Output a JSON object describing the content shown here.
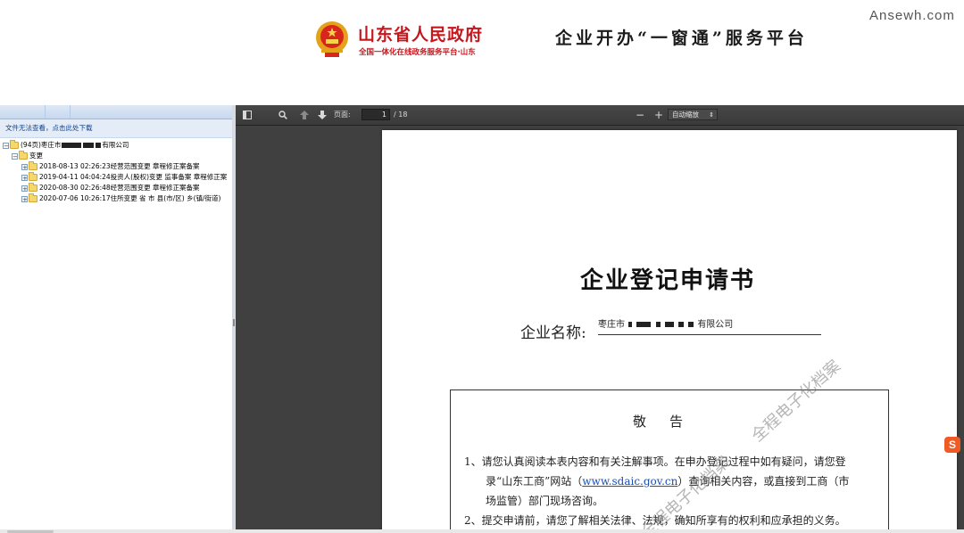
{
  "header": {
    "gov_name": "山东省人民政府",
    "gov_subtitle": "全国一体化在线政务服务平台·山东",
    "platform_title": "企业开办“一窗通”服务平台",
    "site_mark": "Ansewh.com"
  },
  "left_panel": {
    "hint": "文件无法查看，点击此处下载",
    "root_label_prefix": "(94页)枣庄市",
    "root_label_suffix": "有限公司",
    "child_label": "变更",
    "records": [
      {
        "label": "2018-08-13 02:26:23经营范围变更 章程修正案备案"
      },
      {
        "label": "2019-04-11 04:04:24投资人(股权)变更 监事备案 章程修正案"
      },
      {
        "label": "2020-08-30 02:26:48经营范围变更 章程修正案备案"
      },
      {
        "label": "2020-07-06 10:26:17住所变更 省 市 县(市/区) 乡(镇/街道)"
      }
    ]
  },
  "toolbar": {
    "page_label": "页面:",
    "page_value": "1",
    "page_total": "/ 18",
    "zoom_minus": "−",
    "zoom_plus": "+",
    "zoom_value": "自动缩放",
    "zoom_arrow": "⇕"
  },
  "document": {
    "title": "企业登记申请书",
    "company_label": "企业名称:",
    "company_prefix": "枣庄市",
    "company_suffix": "有限公司",
    "notice_title": "敬告",
    "item1_a": "1、请您认真阅读本表内容和有关注解事项。在申办登记过程中如有疑问，请您登",
    "item1_b": "录“山东工商”网站（",
    "item1_link": "www.sdaic.gov.cn",
    "item1_c": "）查询相关内容，或直接到工商（市",
    "item1_d": "场监管）部门现场咨询。",
    "item2": "2、提交申请前，请您了解相关法律、法规，确知所享有的权利和应承担的义务。",
    "watermark_1": "全程电子化档案",
    "watermark_2": "全程电子化档案"
  },
  "colors": {
    "gov_red": "#c8161d",
    "viewer_bg": "#404040",
    "link_blue": "#1a4fb4"
  }
}
